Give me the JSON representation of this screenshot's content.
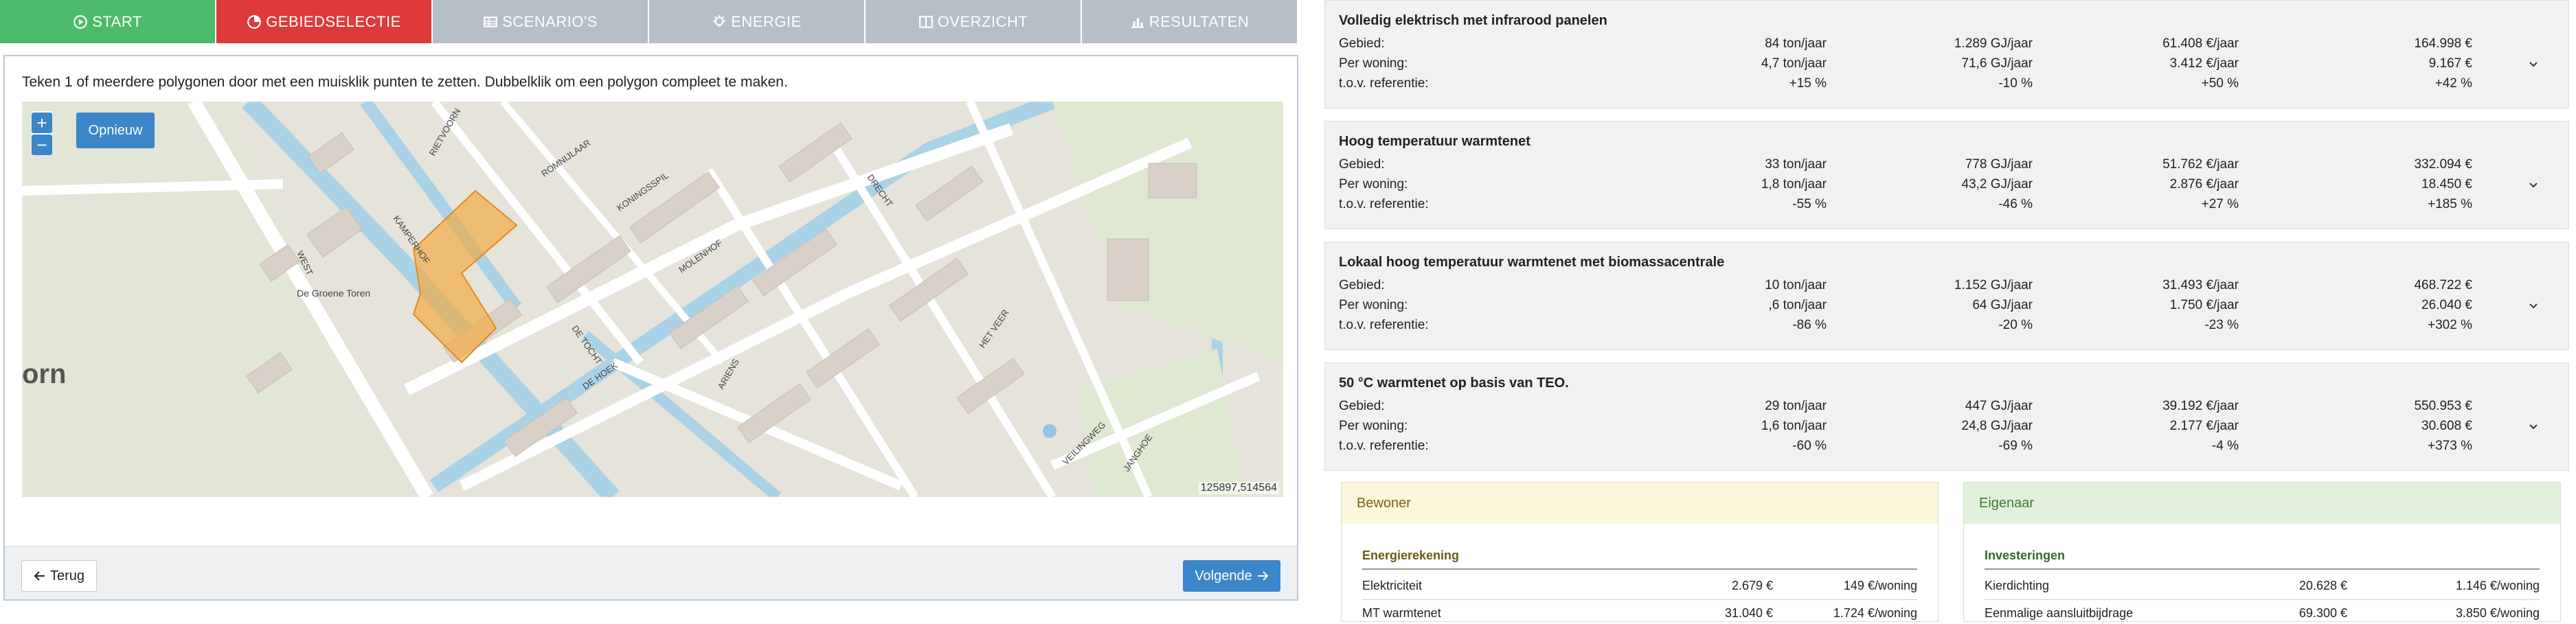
{
  "tabs": [
    {
      "label": "START",
      "icon": "play-circle-icon"
    },
    {
      "label": "GEBIEDSELECTIE",
      "icon": "pie-chart-icon"
    },
    {
      "label": "SCENARIO'S",
      "icon": "table-icon"
    },
    {
      "label": "ENERGIE",
      "icon": "lightbulb-icon"
    },
    {
      "label": "OVERZICHT",
      "icon": "columns-icon"
    },
    {
      "label": "RESULTATEN",
      "icon": "bar-chart-icon"
    }
  ],
  "colors": {
    "start": "#4cbb6c",
    "active": "#de3a3a",
    "inactive": "#b6bfc8",
    "primary": "#3a86c8",
    "selection": "#f2a93b"
  },
  "instruction": "Teken 1 of meerdere polygonen door met een muisklik punten te zetten. Dubbelklik om een polygon compleet te maken.",
  "map": {
    "zoom_in": "+",
    "zoom_out": "−",
    "reset_label": "Opnieuw",
    "coords": "125897,514564",
    "partial_label": "orn",
    "poi_label": "De Groene Toren",
    "street_labels": [
      "RIETVOORN",
      "KAMPERHOF",
      "ROMNIJLAAR",
      "KONINGSSPIL",
      "WEST",
      "MOLENHOF",
      "DE TOCHT",
      "DE HOEK",
      "ARIENS",
      "HET VEER",
      "DRECHT",
      "VEILINGWEG",
      "JANGHOE"
    ]
  },
  "footer": {
    "back_label": "Terug",
    "next_label": "Volgende"
  },
  "scenarios": [
    {
      "title": "Volledig elektrisch met infrarood panelen",
      "rows": [
        {
          "label": "Gebied:",
          "v": [
            "84 ton/jaar",
            "1.289 GJ/jaar",
            "61.408 €/jaar",
            "164.998 €"
          ]
        },
        {
          "label": "Per woning:",
          "v": [
            "4,7 ton/jaar",
            "71,6 GJ/jaar",
            "3.412 €/jaar",
            "9.167 €"
          ]
        },
        {
          "label": "t.o.v. referentie:",
          "v": [
            "+15 %",
            "-10 %",
            "+50 %",
            "+42 %"
          ]
        }
      ]
    },
    {
      "title": "Hoog temperatuur warmtenet",
      "rows": [
        {
          "label": "Gebied:",
          "v": [
            "33 ton/jaar",
            "778 GJ/jaar",
            "51.762 €/jaar",
            "332.094 €"
          ]
        },
        {
          "label": "Per woning:",
          "v": [
            "1,8 ton/jaar",
            "43,2 GJ/jaar",
            "2.876 €/jaar",
            "18.450 €"
          ]
        },
        {
          "label": "t.o.v. referentie:",
          "v": [
            "-55 %",
            "-46 %",
            "+27 %",
            "+185 %"
          ]
        }
      ]
    },
    {
      "title": "Lokaal hoog temperatuur warmtenet met biomassacentrale",
      "rows": [
        {
          "label": "Gebied:",
          "v": [
            "10 ton/jaar",
            "1.152 GJ/jaar",
            "31.493 €/jaar",
            "468.722 €"
          ]
        },
        {
          "label": "Per woning:",
          "v": [
            ",6 ton/jaar",
            "64 GJ/jaar",
            "1.750 €/jaar",
            "26.040 €"
          ]
        },
        {
          "label": "t.o.v. referentie:",
          "v": [
            "-86 %",
            "-20 %",
            "-23 %",
            "+302 %"
          ]
        }
      ]
    },
    {
      "title": "50 °C warmtenet op basis van TEO.",
      "rows": [
        {
          "label": "Gebied:",
          "v": [
            "29 ton/jaar",
            "447 GJ/jaar",
            "39.192 €/jaar",
            "550.953 €"
          ]
        },
        {
          "label": "Per woning:",
          "v": [
            "1,6 ton/jaar",
            "24,8 GJ/jaar",
            "2.177 €/jaar",
            "30.608 €"
          ]
        },
        {
          "label": "t.o.v. referentie:",
          "v": [
            "-60 %",
            "-69 %",
            "-4 %",
            "+373 %"
          ]
        }
      ]
    }
  ],
  "bewoner": {
    "title": "Bewoner",
    "section": "Energierekening",
    "rows": [
      {
        "label": "Elektriciteit",
        "total": "2.679 €",
        "per": "149 €/woning"
      },
      {
        "label": "MT warmtenet",
        "total": "31.040 €",
        "per": "1.724 €/woning"
      }
    ]
  },
  "eigenaar": {
    "title": "Eigenaar",
    "section": "Investeringen",
    "rows": [
      {
        "label": "Kierdichting",
        "total": "20.628 €",
        "per": "1.146 €/woning"
      },
      {
        "label": "Eenmalige aansluitbijdrage",
        "total": "69.300 €",
        "per": "3.850 €/woning"
      }
    ]
  }
}
